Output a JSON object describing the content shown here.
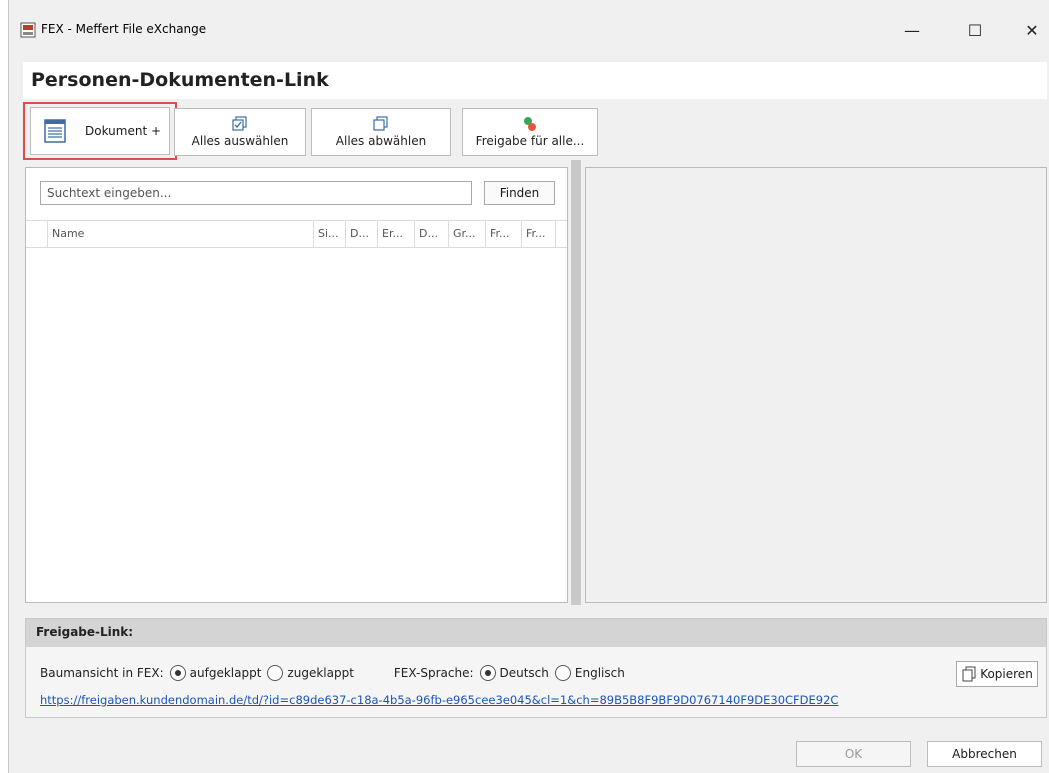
{
  "window": {
    "title": "FEX - Meffert File eXchange",
    "minimize_glyph": "—",
    "maximize_glyph": "☐",
    "close_glyph": "✕"
  },
  "page_title": "Personen-Dokumenten-Link",
  "toolbar": {
    "add_document": "Dokument +",
    "select_all": "Alles auswählen",
    "deselect_all": "Alles abwählen",
    "share_all": "Freigabe für alle..."
  },
  "search": {
    "placeholder": "Suchtext eingeben...",
    "find_label": "Finden"
  },
  "grid": {
    "columns": [
      "Name",
      "Si...",
      "D...",
      "Er...",
      "D...",
      "Gr...",
      "Fr...",
      "Fr..."
    ]
  },
  "share": {
    "section_title": "Freigabe-Link:",
    "tree_view_label": "Baumansicht in FEX:",
    "tree_expanded": "aufgeklappt",
    "tree_collapsed": "zugeklappt",
    "lang_label": "FEX-Sprache:",
    "lang_german": "Deutsch",
    "lang_english": "Englisch",
    "copy_label": "Kopieren",
    "link": "https://freigaben.kundendomain.de/td/?id=c89de637-c18a-4b5a-96fb-e965cee3e045&cl=1&ch=89B5B8F9BF9D0767140F9DE30CFDE92C"
  },
  "footer": {
    "ok": "OK",
    "cancel": "Abbrechen"
  },
  "colors": {
    "highlight_border": "#e04a4a",
    "link": "#1a55b6",
    "window_bg": "#f0f0f0"
  }
}
